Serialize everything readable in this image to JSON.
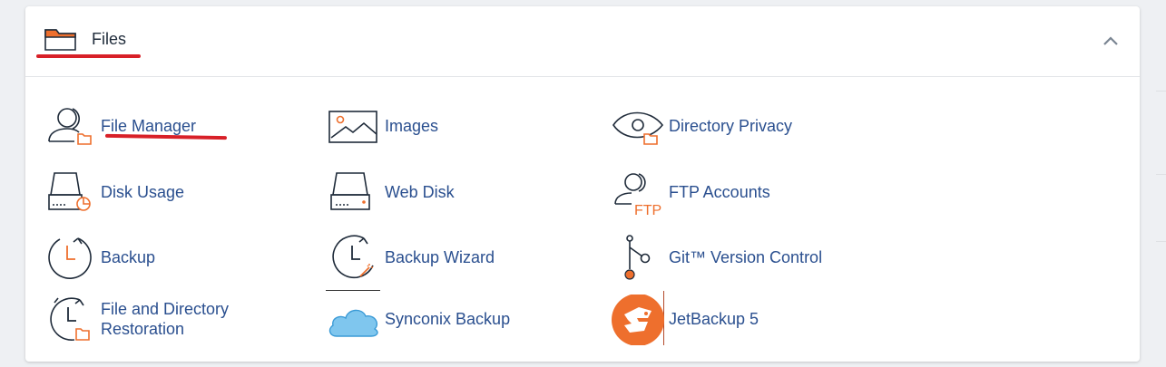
{
  "panel": {
    "title": "Files",
    "icon": "folder-icon",
    "collapse_icon": "chevron-up-icon"
  },
  "accent_colors": {
    "brand": "#ee6f2d",
    "link": "#2a4f8f",
    "annotation": "#d82028"
  },
  "items": [
    {
      "label": "File Manager",
      "icon": "file-manager-icon"
    },
    {
      "label": "Images",
      "icon": "images-icon"
    },
    {
      "label": "Directory Privacy",
      "icon": "directory-privacy-icon"
    },
    {
      "label": "Disk Usage",
      "icon": "disk-usage-icon"
    },
    {
      "label": "Web Disk",
      "icon": "web-disk-icon"
    },
    {
      "label": "FTP Accounts",
      "icon": "ftp-accounts-icon",
      "icon_text": "FTP"
    },
    {
      "label": "Backup",
      "icon": "backup-icon"
    },
    {
      "label": "Backup Wizard",
      "icon": "backup-wizard-icon"
    },
    {
      "label": "Git™ Version Control",
      "icon": "git-icon"
    },
    {
      "label": "File and Directory Restoration",
      "icon": "restoration-icon",
      "label_lines": [
        "File and Directory",
        "Restoration"
      ]
    },
    {
      "label": "Synconix Backup",
      "icon": "cloud-icon"
    },
    {
      "label": "JetBackup 5",
      "icon": "jetbackup-icon"
    }
  ]
}
